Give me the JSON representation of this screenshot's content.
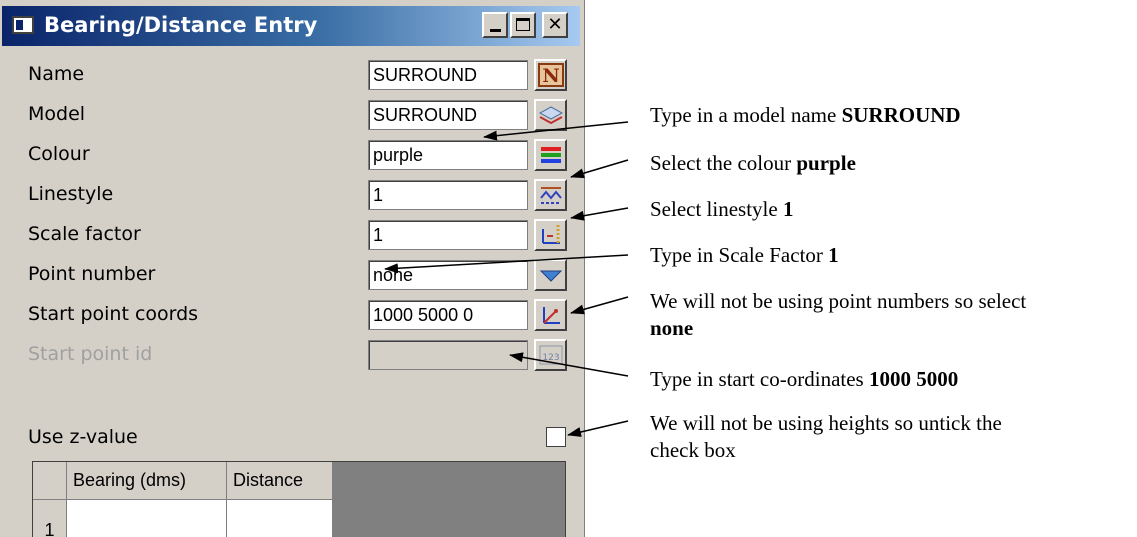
{
  "window": {
    "title": "Bearing/Distance Entry",
    "minimize_label": "",
    "maximize_label": "",
    "close_label": "✕"
  },
  "fields": {
    "name": {
      "label": "Name",
      "value": "SURROUND",
      "button_icon": "name-n-icon"
    },
    "model": {
      "label": "Model",
      "value": "SURROUND",
      "button_icon": "model-layers-icon"
    },
    "colour": {
      "label": "Colour",
      "value": "purple",
      "button_icon": "colour-bars-icon"
    },
    "linestyle": {
      "label": "Linestyle",
      "value": "1",
      "button_icon": "linestyle-icon"
    },
    "scale_factor": {
      "label": "Scale factor",
      "value": "1",
      "button_icon": "scale-icon"
    },
    "point_number": {
      "label": "Point number",
      "value": "none",
      "button_icon": "dropdown-triangle-icon"
    },
    "start_point_coords": {
      "label": "Start point coords",
      "value": "1000 5000 0",
      "button_icon": "coords-pick-icon"
    },
    "start_point_id": {
      "label": "Start point id",
      "value": "",
      "button_icon": "id-123-icon",
      "disabled": true
    },
    "use_z_value": {
      "label": "Use z-value",
      "checked": false
    }
  },
  "grid": {
    "columns": [
      "Bearing (dms)",
      "Distance"
    ],
    "rows": [
      {
        "num": "1",
        "bearing": "",
        "distance": ""
      }
    ]
  },
  "annotations": {
    "model": {
      "text": "Type in a model name ",
      "bold": "SURROUND"
    },
    "colour": {
      "text": "Select the colour ",
      "bold": "purple"
    },
    "linestyle": {
      "text": "Select linestyle ",
      "bold": "1"
    },
    "scale": {
      "text": "Type in Scale Factor ",
      "bold": "1"
    },
    "point_line1": "We will not be using point numbers so select",
    "point_bold": "none",
    "coords": {
      "text": "Type in start co-ordinates ",
      "bold": "1000 5000"
    },
    "height_line1": "We will not be using heights so untick the",
    "height_line2": "check box"
  },
  "colors": {
    "title_start": "#0a246a",
    "title_end": "#a6caf0",
    "dialog_bg": "#d4d0c8",
    "n_button": "#b05a1a"
  }
}
